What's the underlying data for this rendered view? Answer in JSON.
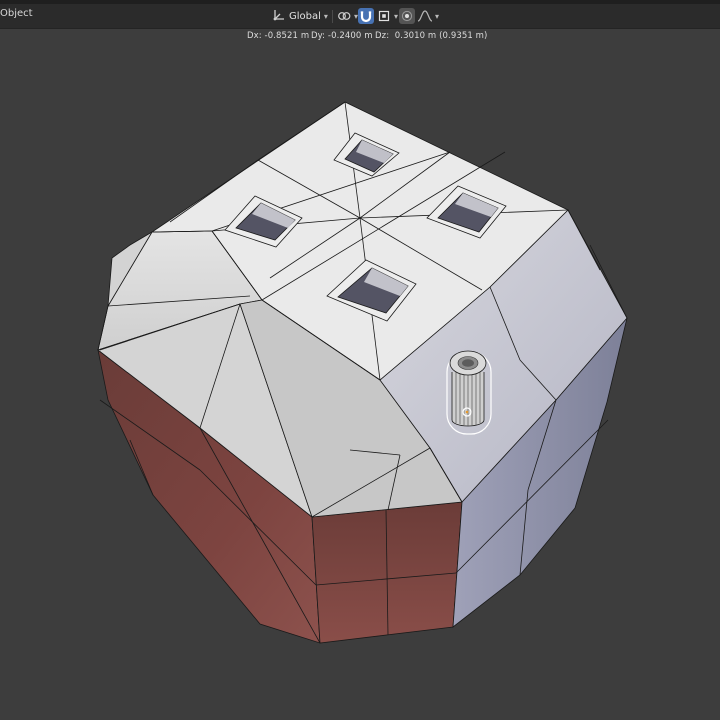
{
  "header": {
    "mode_label": "Object",
    "orientation_label": "Global"
  },
  "readout": {
    "dx": "Dx: -0.8521 m",
    "dy": "Dy: -0.2400 m",
    "dz": "Dz:  0.3010 m (0.9351 m)"
  },
  "icons": {
    "orientation": "transform-orientation-icon",
    "pivot": "pivot-point-icon",
    "snap": "snap-magnet-icon",
    "snap_target": "snap-target-icon",
    "proportional": "proportional-editing-icon",
    "falloff": "falloff-curve-icon",
    "gizmo": "cylinder-gizmo-icon"
  },
  "colors": {
    "header_bg": "#2b2b2b",
    "viewport_bg": "#3d3d3d",
    "active_button": "#4772b3"
  }
}
